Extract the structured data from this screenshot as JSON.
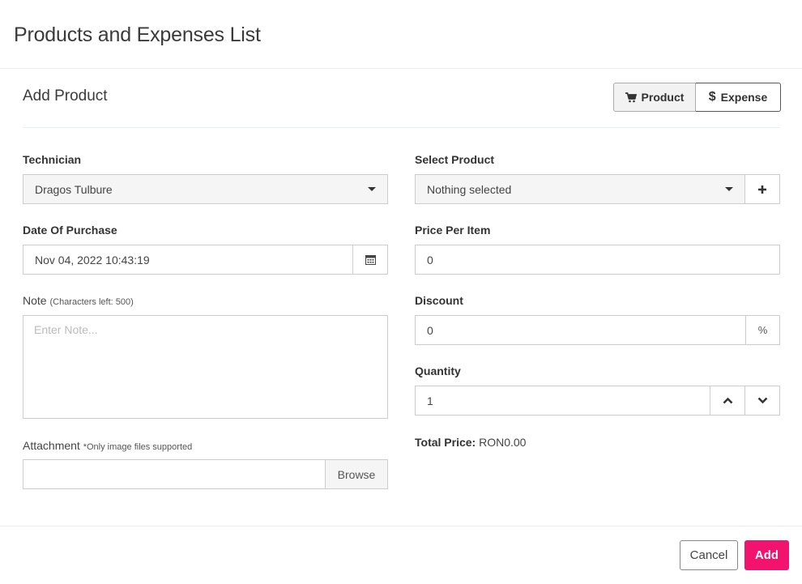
{
  "header": {
    "title": "Products and Expenses List"
  },
  "section": {
    "title": "Add Product",
    "toggle": {
      "product_label": "Product",
      "expense_label": "Expense",
      "product_icon": "cart-icon",
      "expense_icon": "dollar-icon",
      "active": "product"
    }
  },
  "form": {
    "technician": {
      "label": "Technician",
      "value": "Dragos Tulbure"
    },
    "date": {
      "label": "Date Of Purchase",
      "value": "Nov 04, 2022 10:43:19"
    },
    "note": {
      "label": "Note",
      "hint": "(Characters left: 500)",
      "placeholder": "Enter Note..."
    },
    "attachment": {
      "label": "Attachment",
      "hint": "*Only image files supported",
      "browse_label": "Browse"
    },
    "product": {
      "label": "Select Product",
      "value": "Nothing selected"
    },
    "price": {
      "label": "Price Per Item",
      "value": "0"
    },
    "discount": {
      "label": "Discount",
      "value": "0",
      "suffix": "%"
    },
    "quantity": {
      "label": "Quantity",
      "value": "1"
    },
    "total": {
      "label": "Total Price:",
      "value": "RON0.00"
    }
  },
  "footer": {
    "cancel_label": "Cancel",
    "add_label": "Add"
  },
  "colors": {
    "accent": "#f2136f"
  }
}
